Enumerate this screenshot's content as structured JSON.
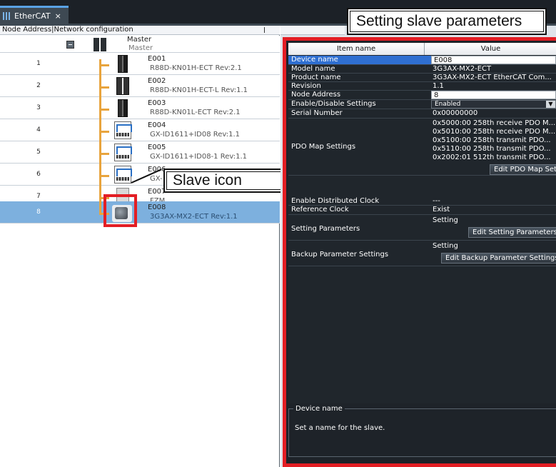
{
  "tab": {
    "label": "EtherCAT",
    "close": "×"
  },
  "left_panel": {
    "header": "Node Address|Network configuration",
    "master": {
      "name": "Master",
      "sub": "Master"
    },
    "nodes": [
      {
        "address": "1",
        "name": "E001",
        "model": "R88D-KN01H-ECT Rev:2.1",
        "icon": "servo-drive-icon"
      },
      {
        "address": "2",
        "name": "E002",
        "model": "R88D-KN01H-ECT-L Rev:1.1",
        "icon": "servo-drive-icon"
      },
      {
        "address": "3",
        "name": "E003",
        "model": "R88D-KN01L-ECT Rev:2.1",
        "icon": "servo-drive-icon"
      },
      {
        "address": "4",
        "name": "E004",
        "model": "GX-ID1611+ID08 Rev:1.1",
        "icon": "digital-io-icon"
      },
      {
        "address": "5",
        "name": "E005",
        "model": "GX-ID1611+ID08-1 Rev:1.1",
        "icon": "digital-io-icon"
      },
      {
        "address": "6",
        "name": "E006",
        "model": "GX-",
        "icon": "digital-io-icon"
      },
      {
        "address": "7",
        "name": "E007",
        "model": "FZM",
        "icon": "vision-sensor-icon"
      },
      {
        "address": "8",
        "name": "E008",
        "model": "3G3AX-MX2-ECT Rev:1.1",
        "icon": "inverter-icon"
      }
    ],
    "selected_address": "8"
  },
  "callouts": {
    "slave_icon": "Slave icon",
    "setting_params": "Setting slave parameters"
  },
  "properties": {
    "col_item": "Item name",
    "col_value": "Value",
    "device_name": {
      "label": "Device name",
      "value": "E008"
    },
    "model_name": {
      "label": "Model name",
      "value": "3G3AX-MX2-ECT"
    },
    "product_name": {
      "label": "Product name",
      "value": "3G3AX-MX2-ECT EtherCAT Com..."
    },
    "revision": {
      "label": "Revision",
      "value": "1.1"
    },
    "node_address": {
      "label": "Node Address",
      "value": "8"
    },
    "enable_disable": {
      "label": "Enable/Disable Settings",
      "value": "Enabled"
    },
    "serial_number": {
      "label": "Serial Number",
      "value": "0x00000000"
    },
    "pdo_map": {
      "label": "PDO Map Settings",
      "values": [
        "0x5000:00 258th receive PDO M...",
        "0x5010:00 258th receive PDO M...",
        "0x5100:00 258th transmit PDO...",
        "0x5110:00 258th transmit PDO...",
        "0x2002:01 512th transmit PDO..."
      ],
      "button": "Edit PDO Map Settings"
    },
    "distributed_clock": {
      "label": "Enable Distributed Clock",
      "value": "---"
    },
    "reference_clock": {
      "label": "Reference Clock",
      "value": "Exist"
    },
    "setting_parameters": {
      "label": "Setting Parameters",
      "value": "Setting",
      "button": "Edit Setting Parameters"
    },
    "backup_parameters": {
      "label": "Backup Parameter Settings",
      "value": "Setting",
      "button": "Edit Backup Parameter Settings"
    }
  },
  "description": {
    "title": "Device name",
    "text": "Set a name for the slave."
  },
  "colors": {
    "highlight_red": "#e31e24",
    "selection_blue": "#7db0de",
    "active_row": "#2f6fd1",
    "connection_orange": "#e8a43d"
  }
}
